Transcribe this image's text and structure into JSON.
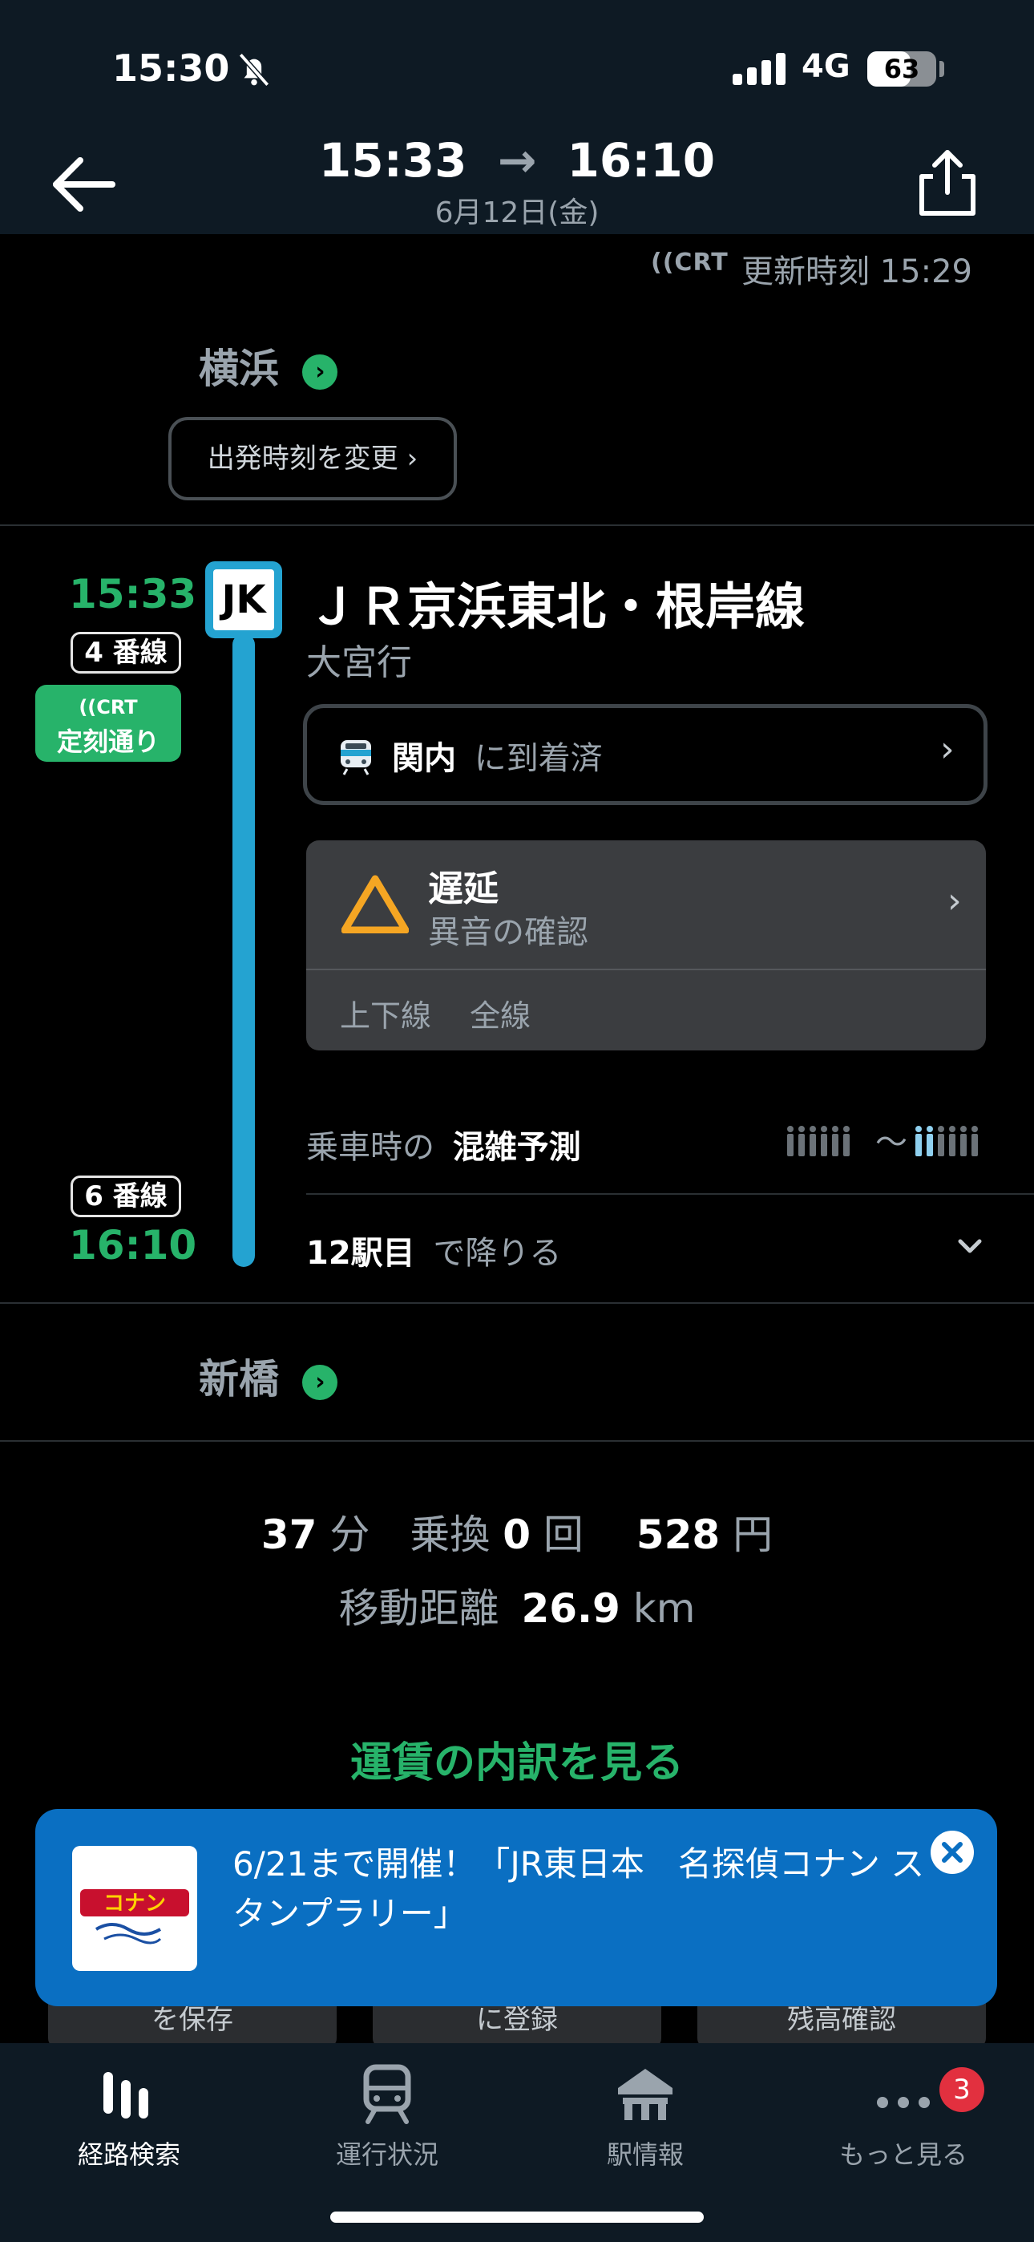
{
  "status_bar": {
    "time": "15:30",
    "network": "4G",
    "battery": "63",
    "battery_level": 0.63,
    "icons": [
      "bell-slash-icon",
      "signal-icon"
    ]
  },
  "header": {
    "departure_time": "15:33",
    "arrow": "→",
    "arrival_time": "16:10",
    "date": "6月12日(金)",
    "icons": [
      "back-arrow-icon",
      "share-icon"
    ]
  },
  "update": {
    "rt_logo": "((CRT",
    "label": "更新時刻 15:29"
  },
  "departure": {
    "station": "横浜",
    "change_time_button": "出発時刻を変更 ›"
  },
  "route": {
    "dep_time": "15:33",
    "dep_platform": "4 番線",
    "rt_badge_top": "((CRT",
    "rt_badge_bottom": "定刻通り",
    "line_code": "JK",
    "line_color": "#24a3d1",
    "line_name": "ＪＲ京浜東北・根岸線",
    "destination": "大宮行",
    "train_position": {
      "station": "関内",
      "status": "に到着済"
    },
    "delay": {
      "title": "遅延",
      "reason": "異音の確認",
      "direction": "上下線",
      "scope": "全線"
    },
    "crowd": {
      "prefix": "乗車時の",
      "label": "混雑予測",
      "tilde": "〜"
    },
    "stops": {
      "count": "12駅目",
      "suffix": "で降りる"
    },
    "arr_platform": "6 番線",
    "arr_time": "16:10"
  },
  "arrival": {
    "station": "新橋"
  },
  "summary": {
    "minutes": "37",
    "minutes_unit": "分",
    "transfer_label": "乗換",
    "transfers": "0",
    "transfer_unit": "回",
    "fare": "528",
    "fare_unit": "円",
    "distance_label": "移動距離",
    "distance": "26.9",
    "distance_unit": "km",
    "fare_link": "運賃の内訳を見る"
  },
  "hidden_buttons": [
    "を保存",
    "に登録",
    "残高確認"
  ],
  "banner": {
    "text": "6/21まで開催！「JR東日本　名探偵コナン スタンプラリー」",
    "thumb_label": "コナン"
  },
  "tabbar": {
    "tabs": [
      {
        "label": "経路検索",
        "icon": "route-search-icon"
      },
      {
        "label": "運行状況",
        "icon": "train-status-icon"
      },
      {
        "label": "駅情報",
        "icon": "station-icon"
      },
      {
        "label": "もっと見る",
        "icon": "more-icon",
        "badge": "3"
      }
    ]
  },
  "colors": {
    "accent_green": "#27b36a",
    "banner_blue": "#0a6fc2",
    "warning": "#f5a623"
  }
}
